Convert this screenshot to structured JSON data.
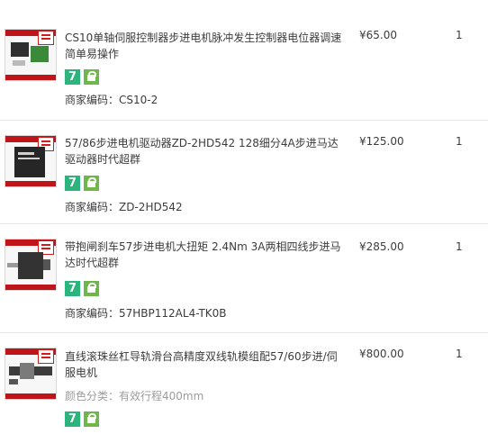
{
  "items": [
    {
      "title": "CS10单轴伺服控制器步进电机脉冲发生控制器电位器调速简单易操作",
      "price": "¥65.00",
      "qty": "1",
      "service_icons": [
        "seven-day-return-icon",
        "consumer-guarantee-icon"
      ],
      "seven_label": "7",
      "code_label": "商家编码：",
      "code_value": "CS10-2"
    },
    {
      "title": "57/86步进电机驱动器ZD-2HD542 128细分4A步进马达驱动器时代超群",
      "price": "¥125.00",
      "qty": "1",
      "service_icons": [
        "seven-day-return-icon",
        "consumer-guarantee-icon"
      ],
      "seven_label": "7",
      "code_label": "商家编码：",
      "code_value": "ZD-2HD542"
    },
    {
      "title": "带抱闸刹车57步进电机大扭矩 2.4Nm 3A两相四线步进马达时代超群",
      "price": "¥285.00",
      "qty": "1",
      "service_icons": [
        "seven-day-return-icon",
        "consumer-guarantee-icon"
      ],
      "seven_label": "7",
      "code_label": "商家编码：",
      "code_value": "57HBP112AL4-TK0B"
    },
    {
      "title": "直线滚珠丝杠导轨滑台高精度双线轨模组配57/60步进/伺服电机",
      "price": "¥800.00",
      "qty": "1",
      "sku_label": "颜色分类：",
      "sku_value": "有效行程400mm",
      "service_icons": [
        "seven-day-return-icon",
        "consumer-guarantee-icon"
      ],
      "seven_label": "7"
    }
  ],
  "colors": {
    "seven_day_green": "#2bb57d",
    "guarantee_green": "#6fb64b",
    "thumb_red": "#c0141b",
    "divider": "#e6e6e6"
  }
}
